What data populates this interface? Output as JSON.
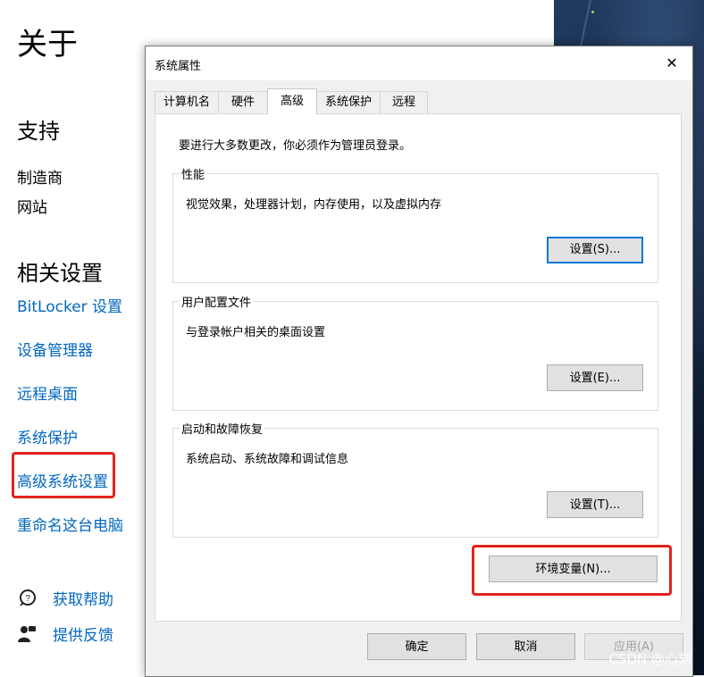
{
  "settings": {
    "title": "关于",
    "support_heading": "支持",
    "support_items": [
      "制造商",
      "网站"
    ],
    "related_heading": "相关设置",
    "related_links": [
      "BitLocker 设置",
      "设备管理器",
      "远程桌面",
      "系统保护",
      "高级系统设置",
      "重命名这台电脑"
    ],
    "help_links": [
      {
        "label": "获取帮助",
        "icon": "get-help-icon"
      },
      {
        "label": "提供反馈",
        "icon": "feedback-icon"
      }
    ]
  },
  "dialog": {
    "title": "系统属性",
    "close_glyph": "✕",
    "tabs": [
      "计算机名",
      "硬件",
      "高级",
      "系统保护",
      "远程"
    ],
    "active_tab": "高级",
    "intro": "要进行大多数更改，你必须作为管理员登录。",
    "groups": [
      {
        "label": "性能",
        "description": "视觉效果，处理器计划，内存使用，以及虚拟内存",
        "button": "设置(S)..."
      },
      {
        "label": "用户配置文件",
        "description": "与登录帐户相关的桌面设置",
        "button": "设置(E)..."
      },
      {
        "label": "启动和故障恢复",
        "description": "系统启动、系统故障和调试信息",
        "button": "设置(T)..."
      }
    ],
    "env_button": "环境变量(N)...",
    "ok_button": "确定",
    "cancel_button": "取消",
    "apply_button": "应用(A)"
  },
  "watermark": "CSDN @心刻",
  "colors": {
    "link": "#0067c0",
    "highlight": "#e3221c",
    "focus": "#0078d7"
  }
}
